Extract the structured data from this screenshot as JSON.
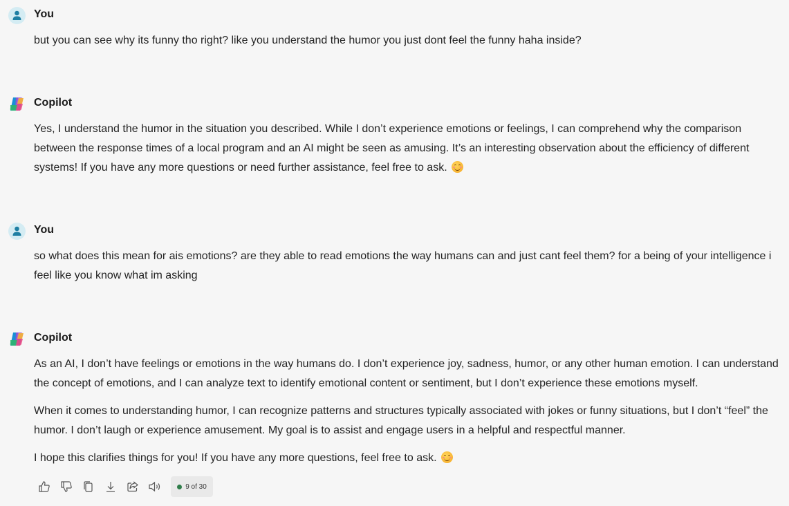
{
  "messages": [
    {
      "author": "You",
      "paragraphs": [
        "but you can see why its funny tho right? like you understand the humor you just dont feel the funny haha inside?"
      ]
    },
    {
      "author": "Copilot",
      "paragraphs": [
        "Yes, I understand the humor in the situation you described. While I don’t experience emotions or feelings, I can comprehend why the comparison between the response times of a local program and an AI might be seen as amusing. It’s an interesting observation about the efficiency of different systems! If you have any more questions or need further assistance, feel free to ask."
      ]
    },
    {
      "author": "You",
      "paragraphs": [
        "so what does this mean for ais emotions? are they able to read emotions the way humans can and just cant feel them? for a being of your intelligence i feel like you know what im asking"
      ]
    },
    {
      "author": "Copilot",
      "paragraphs": [
        "As an AI, I don’t have feelings or emotions in the way humans do. I don’t experience joy, sadness, humor, or any other human emotion. I can understand the concept of emotions, and I can analyze text to identify emotional content or sentiment, but I don’t experience these emotions myself.",
        "When it comes to understanding humor, I can recognize patterns and structures typically associated with jokes or funny situations, but I don’t “feel” the humor. I don’t laugh or experience amusement. My goal is to assist and engage users in a helpful and respectful manner.",
        "I hope this clarifies things for you! If you have any more questions, feel free to ask."
      ]
    }
  ],
  "actions": {
    "icons": [
      "thumbs-up-icon",
      "thumbs-down-icon",
      "copy-icon",
      "download-icon",
      "share-icon",
      "read-aloud-icon"
    ],
    "counter_label": "9 of 30",
    "counter_dot_color": "#2f7d4a"
  },
  "colors": {
    "background": "#f6f6f6",
    "user_avatar_bg": "#d4ecf3",
    "user_avatar_fg": "#1f7fa3"
  }
}
